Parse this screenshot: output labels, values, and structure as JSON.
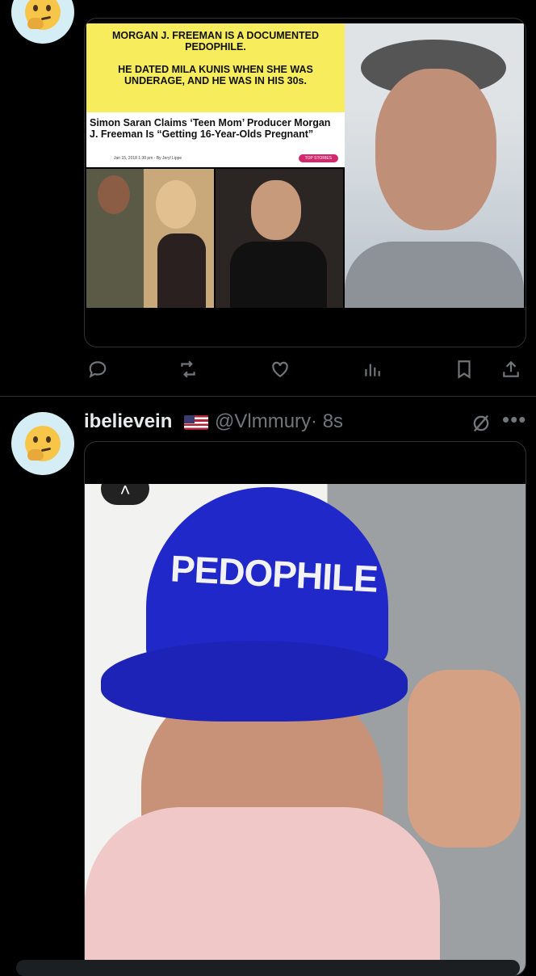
{
  "tweet1": {
    "image_text": {
      "yellow_box": "MORGAN J. FREEMAN IS A DOCUMENTED PEDOPHILE.",
      "yellow_box_2": "HE DATED MILA KUNIS WHEN SHE WAS UNDERAGE, AND HE WAS IN HIS 30s.",
      "headline": "Simon Saran Claims ‘Teen Mom’ Producer Morgan J. Freeman Is “Getting 16-Year-Olds Pregnant”",
      "byline": "Jan 15, 2018 1:30 pm - By Jeryl Lippe",
      "badge": "TOP STORIES"
    }
  },
  "tweet2": {
    "display_name": "ibelievein",
    "handle": "@Vlmmury",
    "time": "· 8s",
    "more": "•••",
    "image_text": {
      "hat": "PEDOPHILE"
    }
  },
  "icons": [
    "reply-icon",
    "retweet-icon",
    "like-icon",
    "views-icon",
    "bookmark-icon",
    "share-icon",
    "grok-icon",
    "more-icon"
  ]
}
